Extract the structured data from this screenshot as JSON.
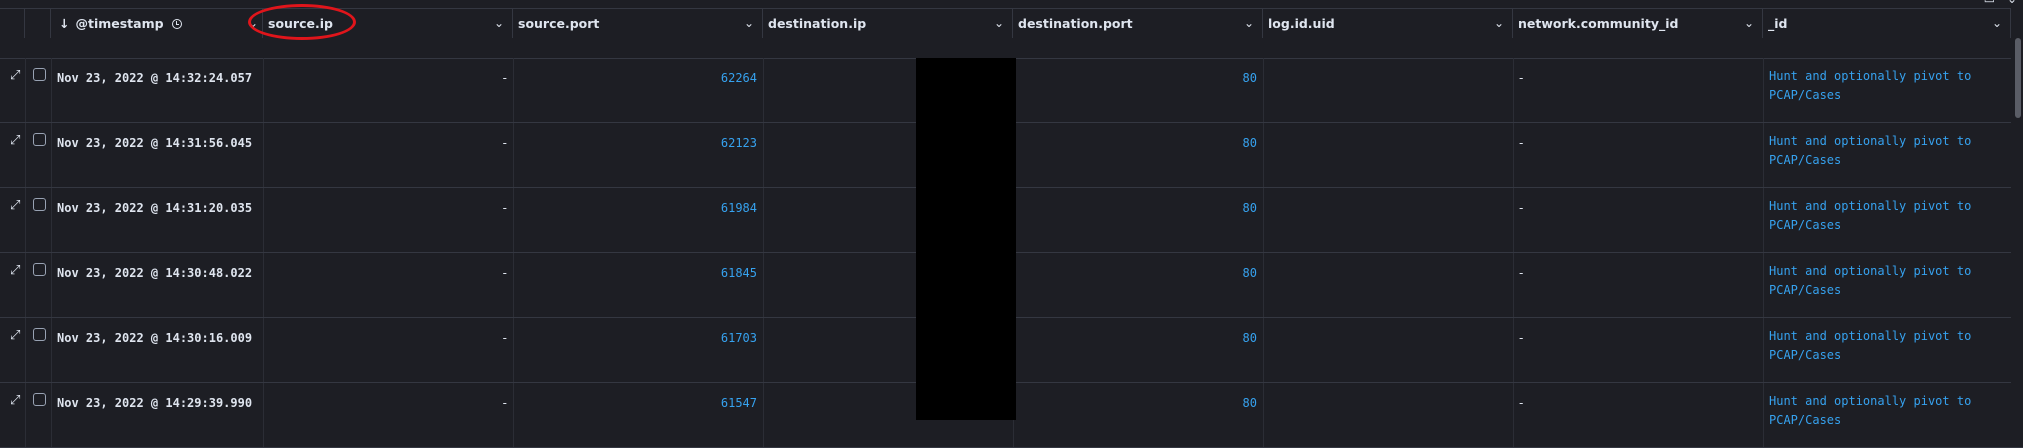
{
  "columns": [
    {
      "key": "timestamp",
      "label": "@timestamp",
      "sort": "desc"
    },
    {
      "key": "source_ip",
      "label": "source.ip"
    },
    {
      "key": "source_port",
      "label": "source.port"
    },
    {
      "key": "destination_ip",
      "label": "destination.ip"
    },
    {
      "key": "destination_port",
      "label": "destination.port"
    },
    {
      "key": "log_id_uid",
      "label": "log.id.uid"
    },
    {
      "key": "network_community_id",
      "label": "network.community_id"
    },
    {
      "key": "id",
      "label": "_id"
    }
  ],
  "rows": [
    {
      "timestamp": "Nov 23, 2022 @ 14:32:24.057",
      "source_ip": "-",
      "source_port": "62264",
      "destination_port": "80",
      "log_id_uid": "",
      "network_community_id": "-",
      "id_line1": "Hunt and optionally pivot to",
      "id_line2": "PCAP/Cases"
    },
    {
      "timestamp": "Nov 23, 2022 @ 14:31:56.045",
      "source_ip": "-",
      "source_port": "62123",
      "destination_port": "80",
      "log_id_uid": "",
      "network_community_id": "-",
      "id_line1": "Hunt and optionally pivot to",
      "id_line2": "PCAP/Cases"
    },
    {
      "timestamp": "Nov 23, 2022 @ 14:31:20.035",
      "source_ip": "-",
      "source_port": "61984",
      "destination_port": "80",
      "log_id_uid": "",
      "network_community_id": "-",
      "id_line1": "Hunt and optionally pivot to",
      "id_line2": "PCAP/Cases"
    },
    {
      "timestamp": "Nov 23, 2022 @ 14:30:48.022",
      "source_ip": "-",
      "source_port": "61845",
      "destination_port": "80",
      "log_id_uid": "",
      "network_community_id": "-",
      "id_line1": "Hunt and optionally pivot to",
      "id_line2": "PCAP/Cases"
    },
    {
      "timestamp": "Nov 23, 2022 @ 14:30:16.009",
      "source_ip": "-",
      "source_port": "61703",
      "destination_port": "80",
      "log_id_uid": "",
      "network_community_id": "-",
      "id_line1": "Hunt and optionally pivot to",
      "id_line2": "PCAP/Cases"
    },
    {
      "timestamp": "Nov 23, 2022 @ 14:29:39.990",
      "source_ip": "-",
      "source_port": "61547",
      "destination_port": "80",
      "log_id_uid": "",
      "network_community_id": "-",
      "id_line1": "Hunt and optionally pivot to",
      "id_line2": "PCAP/Cases"
    }
  ],
  "icons": {
    "sort": "arrow-down-icon",
    "clock": "clock-icon",
    "expand": "expand-icon",
    "chevron": "chevron-down-icon"
  },
  "colors": {
    "background": "#1d1e24",
    "link": "#36a2ef",
    "annotation": "#e0151b",
    "border": "#343741"
  }
}
